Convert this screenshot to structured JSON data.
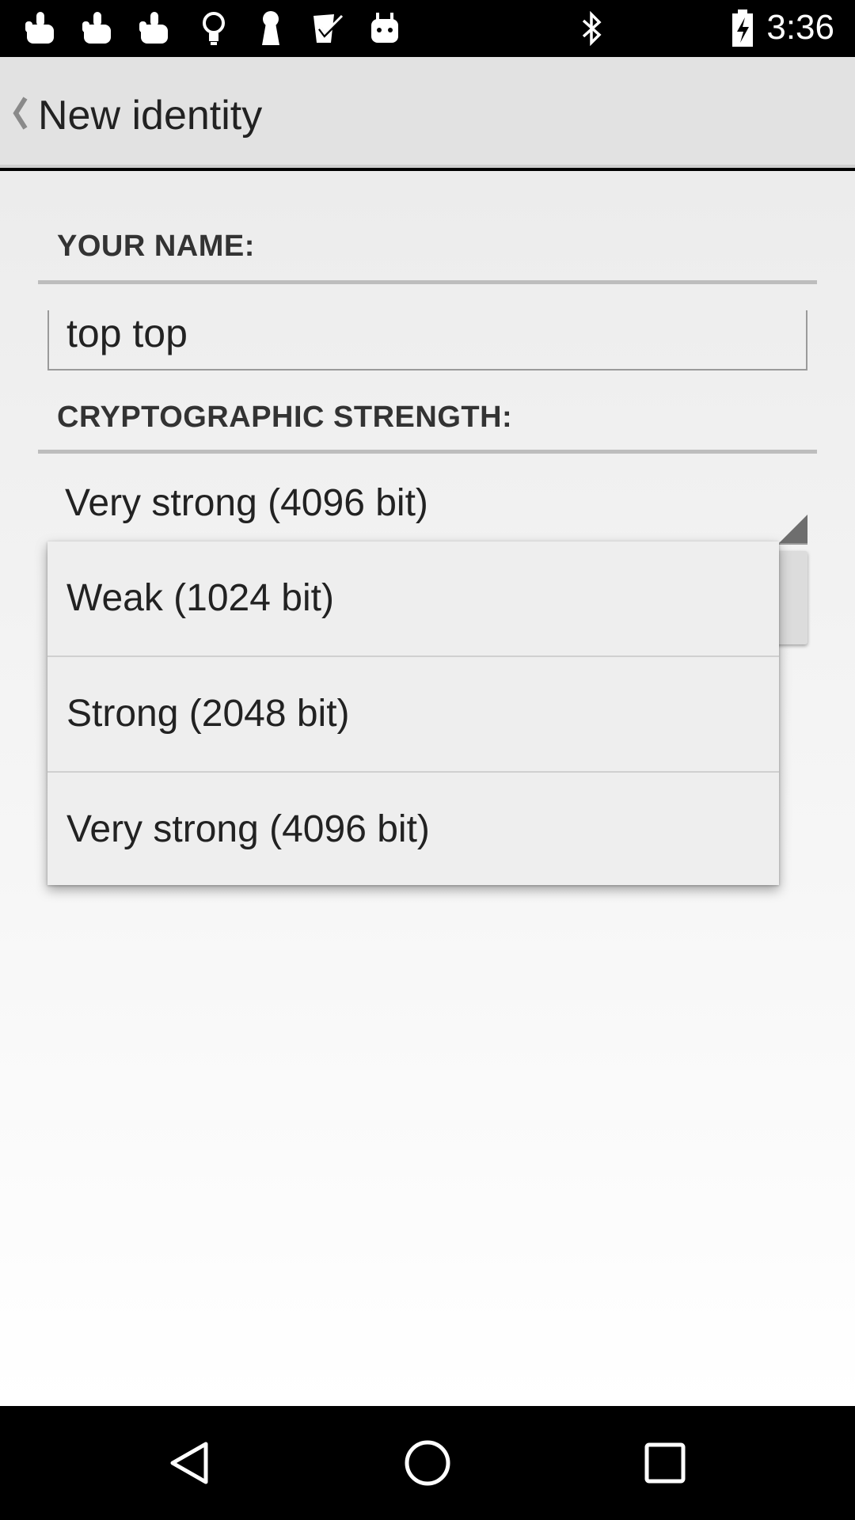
{
  "status_bar": {
    "time": "3:36",
    "left_icons": [
      "hand-touch-icon",
      "hand-touch-icon",
      "hand-touch-icon",
      "lightbulb-icon",
      "keyhole-icon",
      "check-box-icon",
      "android-icon"
    ],
    "right_icons": [
      "bluetooth-icon",
      "battery-icon"
    ]
  },
  "action_bar": {
    "title": "New identity"
  },
  "form": {
    "name_header": "YOUR NAME:",
    "name_value": "top top",
    "strength_header": "CRYPTOGRAPHIC STRENGTH:",
    "strength_selected": "Very strong (4096 bit)"
  },
  "dropdown": {
    "options": [
      {
        "label": "Weak (1024 bit)"
      },
      {
        "label": "Strong (2048 bit)"
      },
      {
        "label": "Very strong (4096 bit)"
      }
    ]
  },
  "nav_bar": {
    "buttons": [
      "back-icon",
      "home-icon",
      "recents-icon"
    ]
  },
  "colors": {
    "action_bar_bg": "#e2e2e2",
    "content_bg": "#f0f0f0",
    "text": "#222222",
    "header_text": "#333333",
    "rule": "#bdbdbd"
  }
}
